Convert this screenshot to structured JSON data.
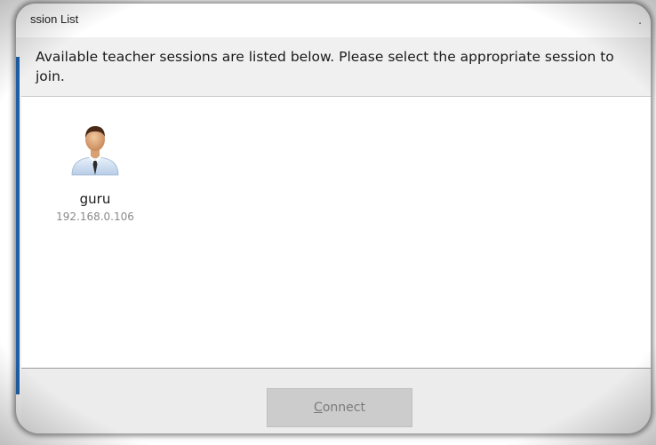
{
  "window": {
    "title": "ssion List",
    "title_trailing": "."
  },
  "instruction": {
    "text": "Available teacher sessions are listed below. Please select the appropriate session to join."
  },
  "sessions": [
    {
      "name": "guru",
      "ip": "192.168.0.106",
      "icon": "teacher-avatar-icon"
    }
  ],
  "footer": {
    "connect_label_mnemonic": "C",
    "connect_label_rest": "onnect",
    "connect_enabled": false
  },
  "colors": {
    "window_bg": "#f0f0f0",
    "list_bg": "#ffffff",
    "button_disabled_bg": "#cccccc",
    "button_disabled_text": "#7a7a7a",
    "accent": "#1f5fa6"
  }
}
